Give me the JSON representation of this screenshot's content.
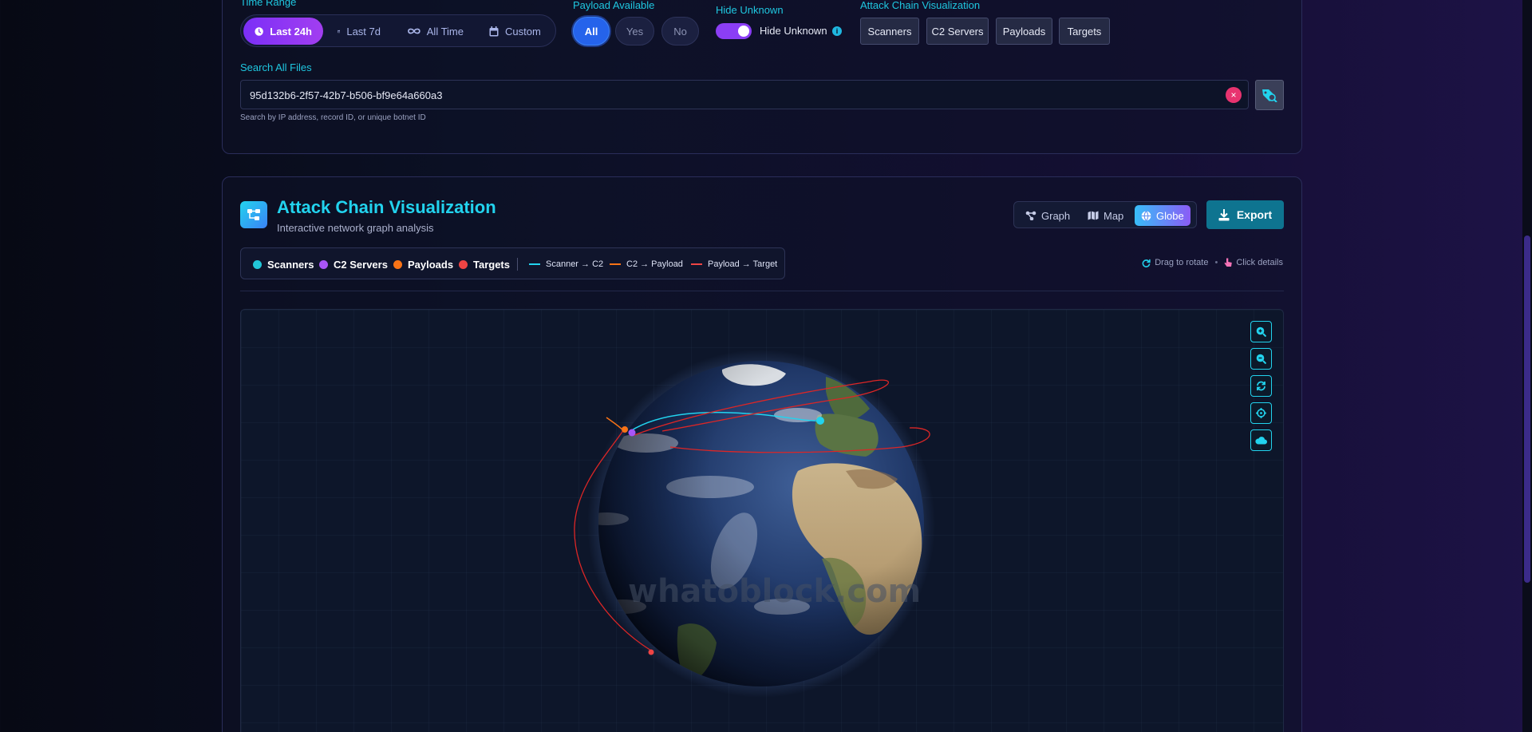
{
  "filters": {
    "time_range": {
      "label": "Time Range",
      "options": [
        "Last 24h",
        "Last 7d",
        "All Time",
        "Custom"
      ],
      "selected": "Last 24h"
    },
    "payload_available": {
      "label": "Payload Available",
      "options": [
        "All",
        "Yes",
        "No"
      ],
      "selected": "All"
    },
    "hide_unknown": {
      "label": "Hide Unknown",
      "toggle_label": "Hide Unknown",
      "enabled": true
    },
    "attack_chain": {
      "label": "Attack Chain Visualization",
      "buttons": [
        "Scanners",
        "C2 Servers",
        "Payloads",
        "Targets"
      ]
    }
  },
  "search": {
    "label": "Search All Files",
    "value": "95d132b6-2f57-42b7-b506-bf9e64a660a3",
    "help": "Search by IP address, record ID, or unique botnet ID"
  },
  "visualization": {
    "title": "Attack Chain Visualization",
    "subtitle": "Interactive network graph analysis",
    "views": [
      "Graph",
      "Map",
      "Globe"
    ],
    "active_view": "Globe",
    "export_label": "Export",
    "legend": {
      "nodes": [
        {
          "label": "Scanners",
          "color": "#22c6d8"
        },
        {
          "label": "C2 Servers",
          "color": "#a855f7"
        },
        {
          "label": "Payloads",
          "color": "#f97316"
        },
        {
          "label": "Targets",
          "color": "#ef4444"
        }
      ],
      "links": [
        {
          "label": "Scanner → C2",
          "color": "#22d3ee"
        },
        {
          "label": "C2 → Payload",
          "color": "#f97316"
        },
        {
          "label": "Payload → Target",
          "color": "#ef4444"
        }
      ]
    },
    "hint_rotate": "Drag to rotate",
    "hint_sep": "•",
    "hint_click": "Click details",
    "watermark": "whatoblock.com"
  },
  "colors": {
    "accent": "#22d3ee",
    "primary": "#7b2ff7",
    "toggle": "#8b3ef5"
  }
}
